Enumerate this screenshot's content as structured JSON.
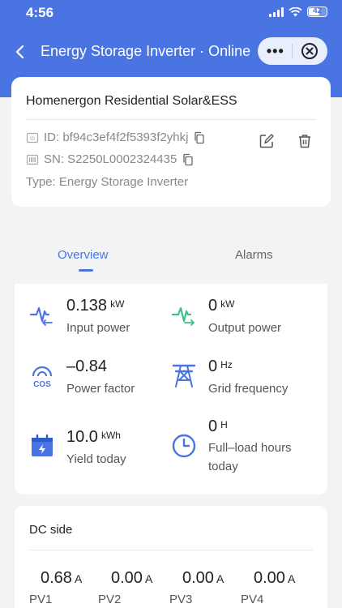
{
  "status_bar": {
    "time": "4:56",
    "battery": "42"
  },
  "nav": {
    "title": "Energy Storage Inverter · Online",
    "more_label": "•••"
  },
  "device": {
    "name": "Homenergon Residential Solar&ESS",
    "id": "ID: bf94c3ef4f2f5393f2yhkj",
    "sn": "SN: S2250L0002324435",
    "type": "Type: Energy Storage Inverter"
  },
  "tabs": {
    "overview": "Overview",
    "alarms": "Alarms"
  },
  "metrics": [
    {
      "value": "0.138",
      "unit": "kW",
      "label": "Input power"
    },
    {
      "value": "0",
      "unit": "kW",
      "label": "Output power"
    },
    {
      "value": "–0.84",
      "unit": "",
      "label": "Power factor"
    },
    {
      "value": "0",
      "unit": "Hz",
      "label": "Grid frequency"
    },
    {
      "value": "10.0",
      "unit": "kWh",
      "label": "Yield today"
    },
    {
      "value": "0",
      "unit": "H",
      "label": "Full–load hours",
      "label2": "today"
    }
  ],
  "dc_side": {
    "title": "DC side",
    "pv": [
      {
        "value": "0.68",
        "unit": "A",
        "label": "PV1"
      },
      {
        "value": "0.00",
        "unit": "A",
        "label": "PV2"
      },
      {
        "value": "0.00",
        "unit": "A",
        "label": "PV3"
      },
      {
        "value": "0.00",
        "unit": "A",
        "label": "PV4"
      }
    ]
  },
  "colors": {
    "accent": "#4a74e2",
    "green": "#3fbf8a",
    "background": "#f2f3f5"
  }
}
